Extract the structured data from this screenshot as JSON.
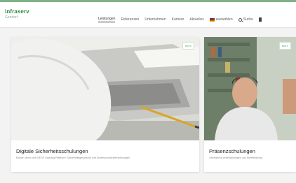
{
  "header": {
    "logo_name": "infraserv",
    "logo_sub": "Gendorf",
    "nav": [
      {
        "label": "Leistungen",
        "active": true
      },
      {
        "label": "Referenzen"
      },
      {
        "label": "Unternehmen"
      },
      {
        "label": "Karriere"
      },
      {
        "label": "Aktuelles"
      },
      {
        "label": "auswählen"
      }
    ],
    "search_label": "Suche"
  },
  "cards": [
    {
      "badge": "Mehr",
      "title": "Digitale Sicherheitsschulungen",
      "description": "Mobile Jacob und SIEGE Learning Plattform: Sicherheitsgespräche und Arbeitsschutzunterweisungen"
    },
    {
      "badge": "Mehr",
      "title": "Präsenzschulungen",
      "description": "Gesetzliche Unterweisungen und Weiterbildung"
    }
  ]
}
